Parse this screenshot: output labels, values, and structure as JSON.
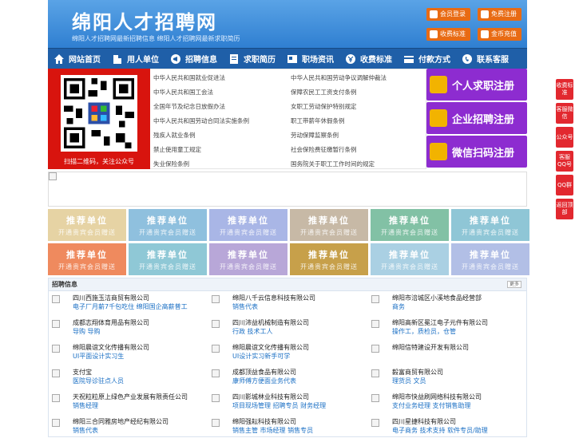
{
  "header": {
    "title": "绵阳人才招聘网",
    "subtitle": "绵阳人才招聘网最新招聘信息   绵阳人才招聘网最新求职简历",
    "buttons": [
      {
        "label": "会员登录",
        "icon": "user-icon"
      },
      {
        "label": "免费注册",
        "icon": "user-add-icon"
      },
      {
        "label": "收费标准",
        "icon": "yen-icon"
      },
      {
        "label": "金币充值",
        "icon": "coin-icon"
      }
    ]
  },
  "nav": [
    {
      "label": "网站首页",
      "icon": "home-icon"
    },
    {
      "label": "用人单位",
      "icon": "building-icon"
    },
    {
      "label": "招聘信息",
      "icon": "megaphone-icon"
    },
    {
      "label": "求职简历",
      "icon": "resume-icon"
    },
    {
      "label": "职场资讯",
      "icon": "news-icon"
    },
    {
      "label": "收费标准",
      "icon": "receipt-icon"
    },
    {
      "label": "付款方式",
      "icon": "wallet-icon"
    },
    {
      "label": "联系客服",
      "icon": "phone-icon"
    }
  ],
  "qr": {
    "caption": "扫描二维码，关注公众号"
  },
  "laws": [
    "中华人民共和国就业促进法",
    "中华人民共和国劳动争议调解仲裁法",
    "中华人民共和国工会法",
    "保障农民工工资支付条例",
    "全国年节及纪念日放假办法",
    "女职工劳动保护特别规定",
    "中华人民共和国劳动合同法实施条例",
    "职工带薪年休假条例",
    "残疾人就业条例",
    "劳动保障监察条例",
    "禁止使用童工规定",
    "社会保险费征缴暂行条例",
    "失业保险条例",
    "国务院关于职工工作时间的规定"
  ],
  "ctas": [
    {
      "label": "个人求职注册",
      "icon": "person-icon"
    },
    {
      "label": "企业招聘注册",
      "icon": "company-icon"
    },
    {
      "label": "微信扫码注册",
      "icon": "wechat-icon"
    }
  ],
  "recommend": {
    "title": "推荐单位",
    "sub": "开通贵宾会员赠送",
    "colors": [
      "#e6d3a4",
      "#8fc0de",
      "#a9b6e6",
      "#c7b9a6",
      "#82c1a5",
      "#8fc6d6",
      "#ef8a5e",
      "#8fc8d6",
      "#b8a7d8",
      "#c7a04a",
      "#aad0e3",
      "#b2bfe6"
    ]
  },
  "jobs": {
    "title": "招聘信息",
    "more": "更多",
    "items": [
      {
        "company": "四川西施玉洁商贸有限公司",
        "position": "电子厂月薪7千包吃住 绵阳国企高薪普工"
      },
      {
        "company": "绵阳八千云信息科技有限公司",
        "position": "销售代表"
      },
      {
        "company": "绵阳市涪城区小溪地食品经营部",
        "position": "商务"
      },
      {
        "company": "成都志翔体育用品有限公司",
        "position": "导购 导购"
      },
      {
        "company": "四川沛益机械制造有限公司",
        "position": "行政 技术工人"
      },
      {
        "company": "绵阳高新区冕江电子元件有限公司",
        "position": "操作工，质检员，仓管"
      },
      {
        "company": "绵阳晨谊文化传播有限公司",
        "position": "UI平面设计实习生"
      },
      {
        "company": "绵阳晨谊文化传播有限公司",
        "position": "UI设计实习新手可学"
      },
      {
        "company": "绵阳信特建设开发有限公司",
        "position": ""
      },
      {
        "company": "支付宝",
        "position": "医院导诊驻点人员"
      },
      {
        "company": "成都顶益食品有限公司",
        "position": "康师傅方便面业务代表"
      },
      {
        "company": "毅富商贸有限公司",
        "position": "理货员 文员"
      },
      {
        "company": "天祝粒粒原上绿色产业发展有限责任公司",
        "position": "销售经理"
      },
      {
        "company": "四川影城林业科技有限公司",
        "position": "项目现场管理 招聘专员 财务经理"
      },
      {
        "company": "绵阳市快益刷网络科技有限公司",
        "position": "支付业务经理 支付销售助理"
      },
      {
        "company": "绵阳三合同雅房地产经纪有限公司",
        "position": "销售代表"
      },
      {
        "company": "绵阳强耘科技有限公司",
        "position": "销售主管 市场经理 销售专员"
      },
      {
        "company": "四川星捷科技有限公司",
        "position": "电子商务 技术支持 软件专员/助理"
      }
    ]
  },
  "float": [
    "收费标准",
    "客服微信",
    "公众号",
    "客服QQ号",
    "QQ群",
    "返回顶部"
  ]
}
